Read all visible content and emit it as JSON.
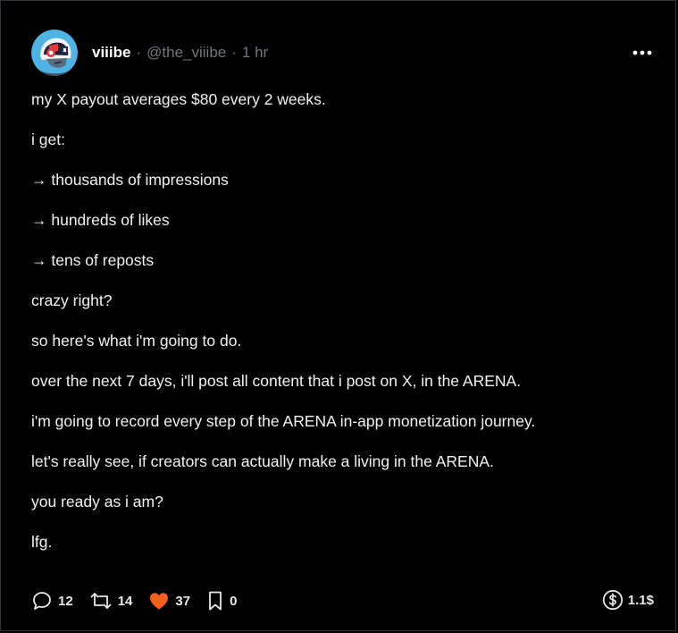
{
  "author": {
    "display_name": "viiibe",
    "handle": "@the_viiibe",
    "separator": "·",
    "time": "1 hr",
    "avatar_icon": "avatar-helmet-icon"
  },
  "more_icon": "ellipsis-icon",
  "paragraphs": [
    "my X payout averages $80 every 2 weeks.",
    "i get:",
    "→ thousands of impressions",
    "→ hundreds of likes",
    "→ tens of reposts",
    "crazy right?",
    "so here's what i'm going to do.",
    "over the next 7 days, i'll post all content that i post on X, in the ARENA.",
    "i'm going to record every step of the ARENA in-app monetization journey.",
    "let's really see, if creators can actually make a living in the ARENA.",
    "you ready as i am?",
    "lfg."
  ],
  "actions": {
    "replies": {
      "icon": "comment-icon",
      "count": "12"
    },
    "reposts": {
      "icon": "repost-icon",
      "count": "14"
    },
    "likes": {
      "icon": "heart-icon",
      "count": "37",
      "color": "#f4611e"
    },
    "bookmarks": {
      "icon": "bookmark-icon",
      "count": "0"
    },
    "tips": {
      "icon": "dollar-icon",
      "amount": "1.1$"
    }
  },
  "colors": {
    "background": "#000000",
    "text": "#e7e9ea",
    "muted": "#71767b",
    "like": "#f4611e",
    "avatar_bg": "#4fb3e6"
  }
}
